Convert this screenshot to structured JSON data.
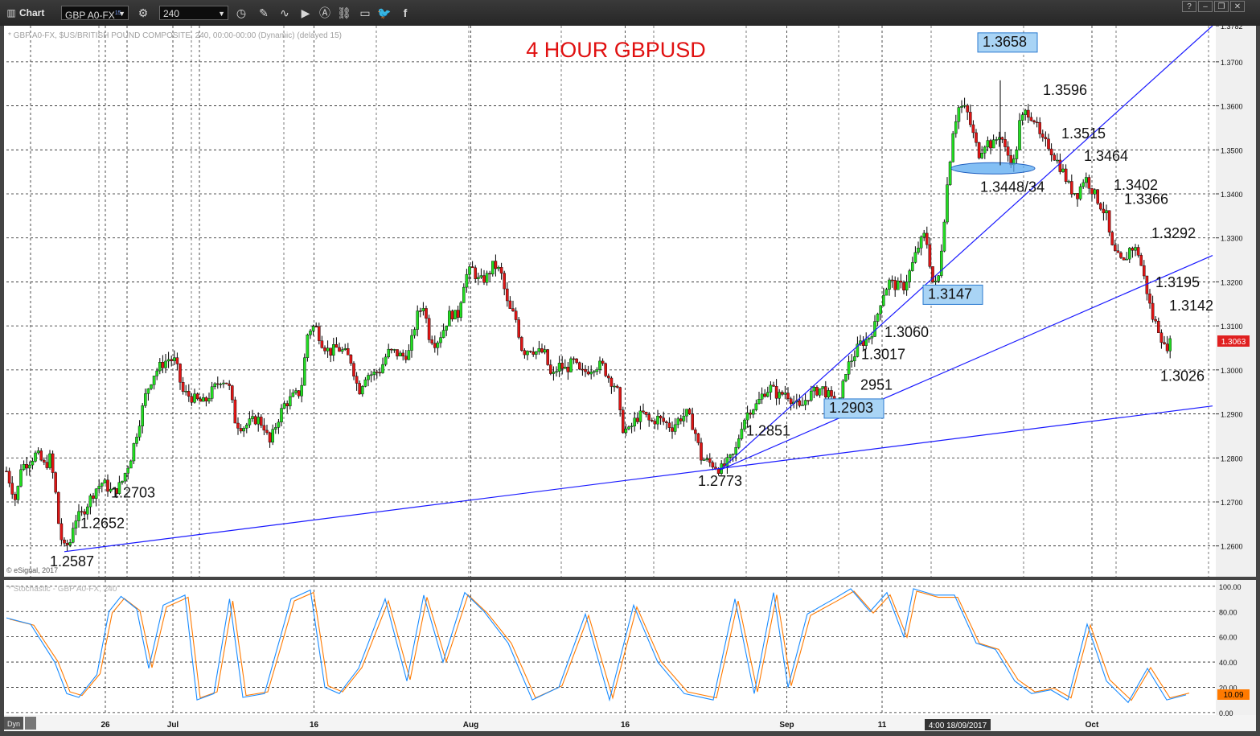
{
  "toolbar": {
    "app_label": "Chart",
    "symbol_value": "GBP A0-FX",
    "symbol_badge": "15",
    "interval_value": "240",
    "icons": [
      "grid-icon",
      "settings-icon",
      "clock-icon",
      "pencil-icon",
      "curve-icon",
      "play-icon",
      "alert-icon",
      "link-icon",
      "comment-icon",
      "twitter-icon",
      "facebook-icon"
    ]
  },
  "chart_data": [
    {
      "type": "candlestick",
      "title": "4 HOUR GBPUSD",
      "subtitle": "* GBP A0-FX, $US/BRITISH POUND COMPOSITE, 240, 00:00-00:00 (Dynamic) (delayed 15)",
      "credit": "© eSignal, 2017",
      "last_price": "1.3063",
      "y_ticks": [
        "1.3782",
        "1.3700",
        "1.3600",
        "1.3500",
        "1.3400",
        "1.3300",
        "1.3200",
        "1.3100",
        "1.3000",
        "1.2900",
        "1.2800",
        "1.2700",
        "1.2600"
      ],
      "ylim": [
        1.253,
        1.3782
      ],
      "x_ticks": [
        "26",
        "Jul",
        "16",
        "Aug",
        "16",
        "Sep",
        "11",
        "Oct"
      ],
      "x_range": [
        0,
        1000
      ],
      "x_tick_positions": [
        82,
        138,
        255,
        385,
        513,
        647,
        726,
        900
      ],
      "cursor_label": "4:00 18/09/2017",
      "path": [
        [
          0,
          1.277
        ],
        [
          8,
          1.27
        ],
        [
          12,
          1.278
        ],
        [
          18,
          1.279
        ],
        [
          25,
          1.281
        ],
        [
          32,
          1.278
        ],
        [
          36,
          1.28
        ],
        [
          40,
          1.274
        ],
        [
          44,
          1.263
        ],
        [
          48,
          1.2595
        ],
        [
          53,
          1.261
        ],
        [
          56,
          1.266
        ],
        [
          62,
          1.267
        ],
        [
          68,
          1.27
        ],
        [
          74,
          1.273
        ],
        [
          80,
          1.2745
        ],
        [
          88,
          1.272
        ],
        [
          95,
          1.274
        ],
        [
          103,
          1.28
        ],
        [
          110,
          1.288
        ],
        [
          116,
          1.295
        ],
        [
          122,
          1.299
        ],
        [
          128,
          1.301
        ],
        [
          134,
          1.3025
        ],
        [
          140,
          1.302
        ],
        [
          146,
          1.295
        ],
        [
          152,
          1.294
        ],
        [
          158,
          1.293
        ],
        [
          164,
          1.2925
        ],
        [
          170,
          1.295
        ],
        [
          178,
          1.298
        ],
        [
          184,
          1.297
        ],
        [
          190,
          1.288
        ],
        [
          196,
          1.287
        ],
        [
          202,
          1.288
        ],
        [
          208,
          1.289
        ],
        [
          214,
          1.287
        ],
        [
          218,
          1.283
        ],
        [
          224,
          1.288
        ],
        [
          230,
          1.292
        ],
        [
          238,
          1.294
        ],
        [
          244,
          1.295
        ],
        [
          250,
          1.309
        ],
        [
          256,
          1.31
        ],
        [
          262,
          1.306
        ],
        [
          268,
          1.304
        ],
        [
          274,
          1.305
        ],
        [
          280,
          1.304
        ],
        [
          286,
          1.302
        ],
        [
          292,
          1.295
        ],
        [
          298,
          1.299
        ],
        [
          304,
          1.299
        ],
        [
          310,
          1.3
        ],
        [
          316,
          1.304
        ],
        [
          322,
          1.304
        ],
        [
          328,
          1.303
        ],
        [
          334,
          1.304
        ],
        [
          340,
          1.312
        ],
        [
          346,
          1.315
        ],
        [
          350,
          1.308
        ],
        [
          356,
          1.306
        ],
        [
          362,
          1.309
        ],
        [
          368,
          1.313
        ],
        [
          374,
          1.312
        ],
        [
          380,
          1.321
        ],
        [
          386,
          1.323
        ],
        [
          392,
          1.32
        ],
        [
          398,
          1.321
        ],
        [
          404,
          1.324
        ],
        [
          410,
          1.322
        ],
        [
          416,
          1.314
        ],
        [
          422,
          1.312
        ],
        [
          428,
          1.304
        ],
        [
          434,
          1.305
        ],
        [
          440,
          1.304
        ],
        [
          446,
          1.304
        ],
        [
          452,
          1.298
        ],
        [
          458,
          1.301
        ],
        [
          464,
          1.3
        ],
        [
          470,
          1.302
        ],
        [
          476,
          1.299
        ],
        [
          482,
          1.3
        ],
        [
          488,
          1.301
        ],
        [
          494,
          1.301
        ],
        [
          500,
          1.298
        ],
        [
          506,
          1.296
        ],
        [
          510,
          1.287
        ],
        [
          516,
          1.286
        ],
        [
          522,
          1.289
        ],
        [
          528,
          1.29
        ],
        [
          534,
          1.288
        ],
        [
          540,
          1.289
        ],
        [
          546,
          1.288
        ],
        [
          552,
          1.287
        ],
        [
          558,
          1.289
        ],
        [
          564,
          1.29
        ],
        [
          570,
          1.287
        ],
        [
          576,
          1.28
        ],
        [
          582,
          1.279
        ],
        [
          586,
          1.2785
        ],
        [
          592,
          1.2773
        ],
        [
          598,
          1.279
        ],
        [
          604,
          1.281
        ],
        [
          610,
          1.288
        ],
        [
          616,
          1.291
        ],
        [
          622,
          1.292
        ],
        [
          628,
          1.295
        ],
        [
          634,
          1.296
        ],
        [
          640,
          1.294
        ],
        [
          646,
          1.295
        ],
        [
          652,
          1.293
        ],
        [
          658,
          1.291
        ],
        [
          664,
          1.294
        ],
        [
          670,
          1.295
        ],
        [
          676,
          1.296
        ],
        [
          682,
          1.294
        ],
        [
          686,
          1.292
        ],
        [
          690,
          1.291
        ],
        [
          696,
          1.3
        ],
        [
          702,
          1.303
        ],
        [
          708,
          1.306
        ],
        [
          714,
          1.307
        ],
        [
          720,
          1.31
        ],
        [
          726,
          1.317
        ],
        [
          732,
          1.32
        ],
        [
          738,
          1.319
        ],
        [
          744,
          1.319
        ],
        [
          750,
          1.323
        ],
        [
          756,
          1.328
        ],
        [
          762,
          1.331
        ],
        [
          768,
          1.32
        ],
        [
          772,
          1.319
        ],
        [
          776,
          1.33
        ],
        [
          780,
          1.342
        ],
        [
          785,
          1.355
        ],
        [
          790,
          1.36
        ],
        [
          796,
          1.359
        ],
        [
          802,
          1.353
        ],
        [
          806,
          1.349
        ],
        [
          812,
          1.352
        ],
        [
          818,
          1.351
        ],
        [
          824,
          1.354
        ],
        [
          828,
          1.35
        ],
        [
          832,
          1.348
        ],
        [
          836,
          1.347
        ],
        [
          840,
          1.356
        ],
        [
          846,
          1.359
        ],
        [
          852,
          1.357
        ],
        [
          858,
          1.352
        ],
        [
          864,
          1.351
        ],
        [
          870,
          1.348
        ],
        [
          876,
          1.345
        ],
        [
          882,
          1.341
        ],
        [
          888,
          1.34
        ],
        [
          894,
          1.344
        ],
        [
          900,
          1.341
        ],
        [
          906,
          1.338
        ],
        [
          912,
          1.335
        ],
        [
          916,
          1.328
        ],
        [
          920,
          1.326
        ],
        [
          926,
          1.324
        ],
        [
          932,
          1.328
        ],
        [
          938,
          1.327
        ],
        [
          944,
          1.32
        ],
        [
          950,
          1.312
        ],
        [
          956,
          1.309
        ],
        [
          960,
          1.305
        ],
        [
          966,
          1.3063
        ]
      ]
    },
    {
      "type": "line",
      "title": "* Stochastic - GBP A0-FX, 240",
      "y_ticks": [
        "100.00",
        "80.00",
        "60.00",
        "40.00",
        "20.00",
        "0.00"
      ],
      "ylim": [
        -2,
        105
      ],
      "last_value": "10.09",
      "series_values": [
        [
          0,
          75
        ],
        [
          20,
          70
        ],
        [
          40,
          40
        ],
        [
          50,
          15
        ],
        [
          60,
          12
        ],
        [
          75,
          30
        ],
        [
          85,
          80
        ],
        [
          95,
          92
        ],
        [
          108,
          82
        ],
        [
          118,
          35
        ],
        [
          130,
          85
        ],
        [
          148,
          93
        ],
        [
          158,
          10
        ],
        [
          172,
          15
        ],
        [
          185,
          90
        ],
        [
          196,
          12
        ],
        [
          214,
          15
        ],
        [
          236,
          90
        ],
        [
          252,
          97
        ],
        [
          264,
          20
        ],
        [
          276,
          15
        ],
        [
          292,
          35
        ],
        [
          314,
          90
        ],
        [
          332,
          25
        ],
        [
          346,
          93
        ],
        [
          362,
          40
        ],
        [
          380,
          95
        ],
        [
          396,
          80
        ],
        [
          416,
          55
        ],
        [
          436,
          10
        ],
        [
          458,
          20
        ],
        [
          480,
          78
        ],
        [
          500,
          10
        ],
        [
          520,
          85
        ],
        [
          540,
          40
        ],
        [
          562,
          15
        ],
        [
          586,
          10
        ],
        [
          604,
          90
        ],
        [
          620,
          15
        ],
        [
          636,
          95
        ],
        [
          648,
          20
        ],
        [
          664,
          78
        ],
        [
          686,
          90
        ],
        [
          700,
          98
        ],
        [
          716,
          80
        ],
        [
          730,
          95
        ],
        [
          744,
          60
        ],
        [
          752,
          98
        ],
        [
          770,
          93
        ],
        [
          786,
          93
        ],
        [
          804,
          55
        ],
        [
          820,
          50
        ],
        [
          836,
          25
        ],
        [
          850,
          15
        ],
        [
          866,
          18
        ],
        [
          880,
          10
        ],
        [
          896,
          70
        ],
        [
          912,
          25
        ],
        [
          930,
          8
        ],
        [
          946,
          35
        ],
        [
          962,
          10
        ],
        [
          978,
          14
        ]
      ]
    }
  ],
  "annotations": {
    "labels": [
      {
        "text": "1.2587",
        "x": 48,
        "y": 1.2587
      },
      {
        "text": "1.2652",
        "x": 56,
        "y": 1.2652
      },
      {
        "text": "1.2703",
        "x": 80,
        "y": 1.2703
      },
      {
        "text": "1.2773",
        "x": 592,
        "y": 1.2773
      },
      {
        "text": "1.2851",
        "x": 640,
        "y": 1.2851
      },
      {
        "text": "1.2903",
        "x": 690,
        "y": 1.2903,
        "boxed": true
      },
      {
        "text": "2951",
        "x": 700,
        "y": 1.2951
      },
      {
        "text": "1.3017",
        "x": 702,
        "y": 1.3017
      },
      {
        "text": "1.3060",
        "x": 720,
        "y": 1.306
      },
      {
        "text": "1.3147",
        "x": 772,
        "y": 1.3147,
        "boxed": true
      },
      {
        "text": "1.3658",
        "x": 824,
        "y": 1.3658,
        "boxed": true
      },
      {
        "text": "1.3596",
        "x": 850,
        "y": 1.3596
      },
      {
        "text": "1.3448/34",
        "x": 830,
        "y": 1.3448
      },
      {
        "text": "1.3515",
        "x": 868,
        "y": 1.3515
      },
      {
        "text": "1.3464",
        "x": 884,
        "y": 1.3464
      },
      {
        "text": "1.3402",
        "x": 910,
        "y": 1.3402
      },
      {
        "text": "1.3366",
        "x": 920,
        "y": 1.3366
      },
      {
        "text": "1.3292",
        "x": 940,
        "y": 1.3292
      },
      {
        "text": "1.3195",
        "x": 946,
        "y": 1.3195
      },
      {
        "text": "1.3142",
        "x": 956,
        "y": 1.3142
      },
      {
        "text": "1.3026",
        "x": 962,
        "y": 1.3026
      }
    ],
    "trendlines": [
      [
        [
          48,
          1.2587
        ],
        [
          1000,
          1.2918
        ]
      ],
      [
        [
          592,
          1.2773
        ],
        [
          1000,
          1.326
        ]
      ],
      [
        [
          592,
          1.2773
        ],
        [
          1000,
          1.3782
        ]
      ]
    ]
  }
}
